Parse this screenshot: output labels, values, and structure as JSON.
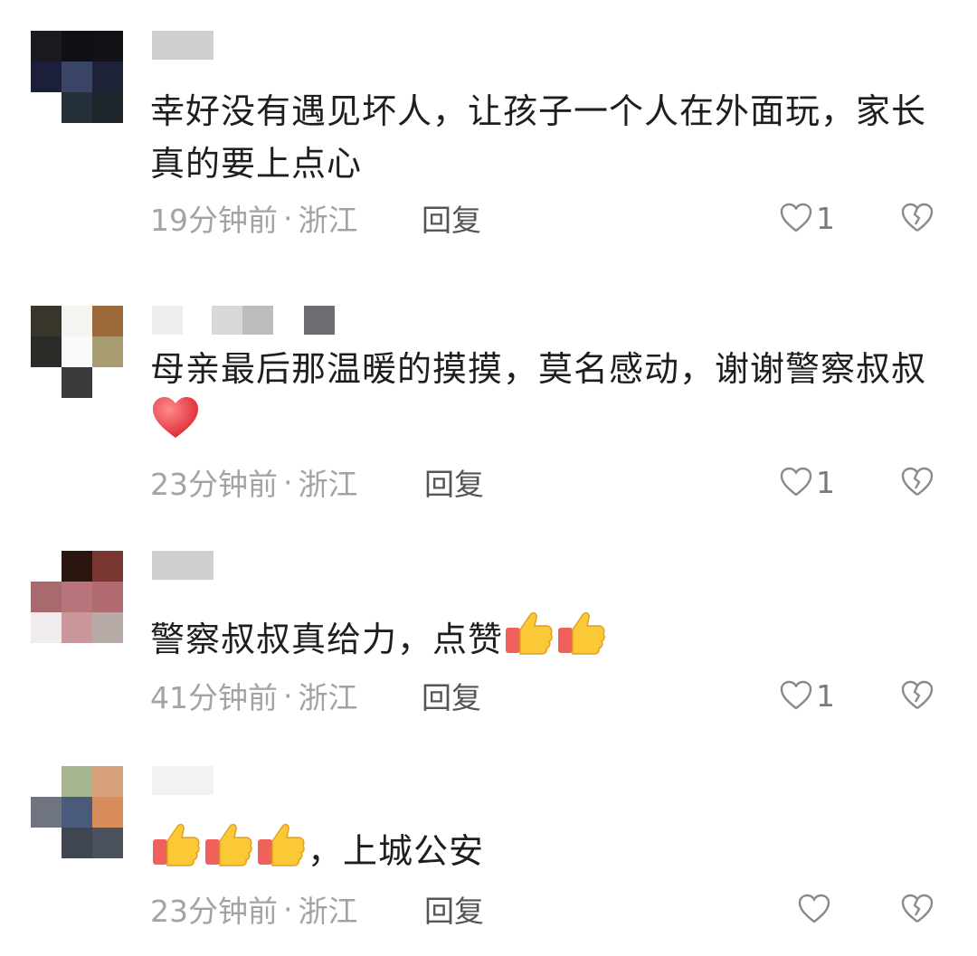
{
  "colors": {
    "meta_text": "#a3a3a3",
    "body_text": "#1e1e1e",
    "reply_text": "#555555",
    "icon_stroke": "#8a8a8a",
    "heart_red": "#e8323c"
  },
  "comments": [
    {
      "avatar_pixels": [
        "#1b1b1f",
        "#101014",
        "#121216",
        "#1c1f3a",
        "#3a4566",
        "#1e2236",
        "#ffffff",
        "#26303a",
        "#1f262c"
      ],
      "name_blocks": [
        "#cfcfcf"
      ],
      "text": "幸好没有遇见坏人，让孩子一个人在外面玩，家长真的要上点心",
      "emoji": [],
      "time": "19分钟前",
      "sep": "·",
      "location": "浙江",
      "reply_label": "回复",
      "like_count": "1"
    },
    {
      "avatar_pixels": [
        "#3a352a",
        "#f4f4f0",
        "#9c6a3a",
        "#2b2b28",
        "#fafafa",
        "#a79c72",
        "#ffffff",
        "#3a3a3c",
        "#ffffff"
      ],
      "name_blocks": [
        "#ededed",
        "#d8d8d8",
        "#bcbcbc",
        "#6e6e72"
      ],
      "text": "母亲最后那温暖的摸摸，莫名感动，谢谢警察叔叔",
      "emoji": [
        "red-heart"
      ],
      "time": "23分钟前",
      "sep": "·",
      "location": "浙江",
      "reply_label": "回复",
      "like_count": "1"
    },
    {
      "avatar_pixels": [
        "#ffffff",
        "#2a1510",
        "#7a3630",
        "#a86a6c",
        "#b7747a",
        "#b06a70",
        "#f0eced",
        "#c9979a",
        "#b8aaa6"
      ],
      "name_blocks": [
        "#cfcfcf"
      ],
      "text": "警察叔叔真给力，点赞",
      "emoji": [
        "thumbs-up",
        "thumbs-up"
      ],
      "time": "41分钟前",
      "sep": "·",
      "location": "浙江",
      "reply_label": "回复",
      "like_count": "1"
    },
    {
      "avatar_pixels": [
        "#ffffff",
        "#a6b490",
        "#d8a37a",
        "#6f7580",
        "#4a5a7a",
        "#d98c5c",
        "#ffffff",
        "#3f4652",
        "#4a515c"
      ],
      "name_blocks": [
        "#f2f2f2"
      ],
      "text": "，上城公安",
      "emoji_prefix": [
        "thumbs-up",
        "thumbs-up",
        "thumbs-up"
      ],
      "emoji": [],
      "time": "23分钟前",
      "sep": "·",
      "location": "浙江",
      "reply_label": "回复",
      "like_count": ""
    }
  ]
}
